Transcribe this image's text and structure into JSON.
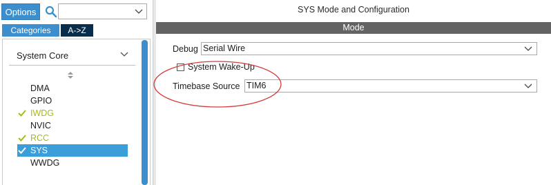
{
  "left_panel": {
    "options_label": "Options",
    "search_value": "",
    "tabs": {
      "categories": "Categories",
      "az": "A->Z"
    },
    "group": {
      "label": "System Core"
    },
    "items": [
      {
        "label": "DMA",
        "status": "none"
      },
      {
        "label": "GPIO",
        "status": "none"
      },
      {
        "label": "IWDG",
        "status": "configured"
      },
      {
        "label": "NVIC",
        "status": "none"
      },
      {
        "label": "RCC",
        "status": "configured"
      },
      {
        "label": "SYS",
        "status": "configured-selected"
      },
      {
        "label": "WWDG",
        "status": "none"
      }
    ]
  },
  "right_panel": {
    "title": "SYS Mode and Configuration",
    "mode_header": "Mode",
    "debug": {
      "label": "Debug",
      "value": "Serial Wire"
    },
    "wakeup": {
      "label": "System Wake-Up",
      "checked": false
    },
    "timebase": {
      "label": "Timebase Source",
      "value": "TIM6"
    }
  },
  "colors": {
    "accent": "#3c8fcc",
    "tab_dark": "#0b2d4c",
    "selected_row": "#3c9ed9",
    "check_green": "#a6b91c",
    "mode_bar": "#636363",
    "annotation_red": "#d23a3a"
  },
  "icons": {
    "search": "search-icon",
    "dropdown": "chevron-down-icon",
    "check": "check-icon",
    "sort": "sort-icon"
  }
}
